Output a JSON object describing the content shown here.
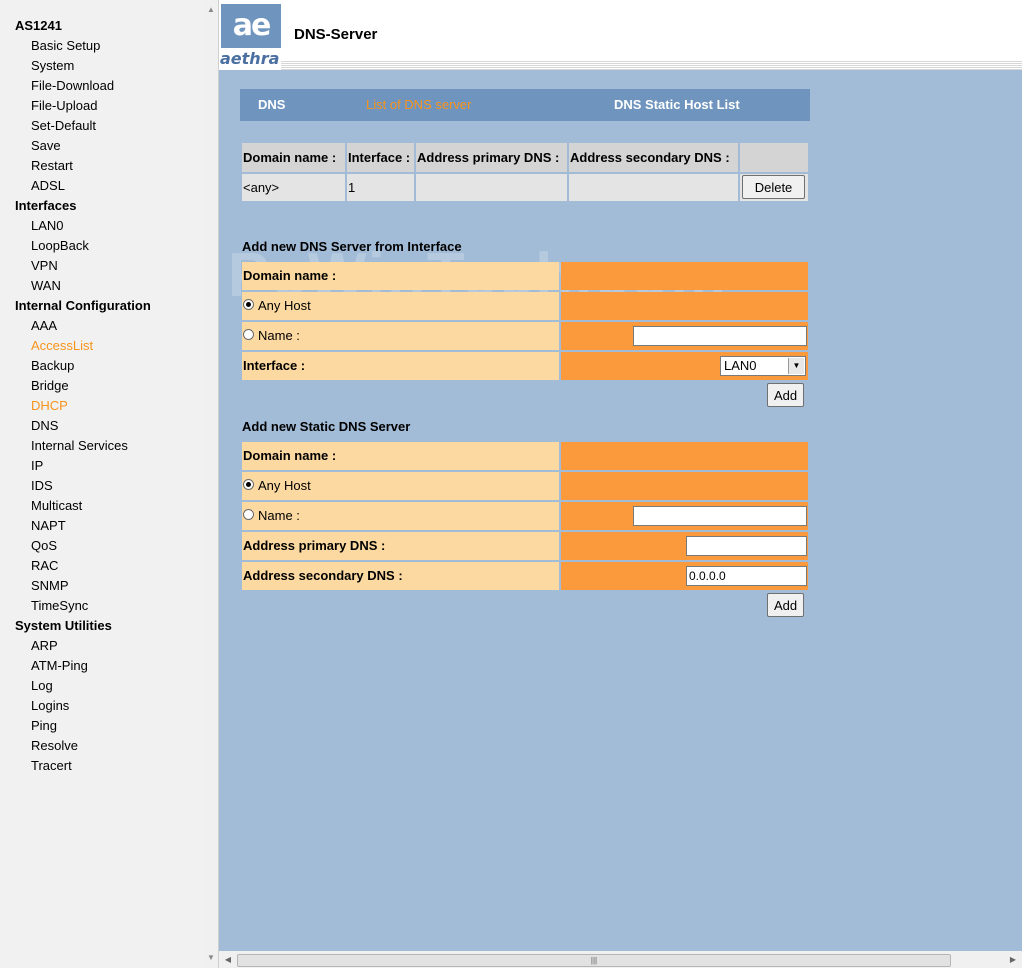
{
  "nav": {
    "groups": [
      {
        "title": "AS1241",
        "items": [
          "Basic Setup",
          "System",
          "File-Download",
          "File-Upload",
          "Set-Default",
          "Save",
          "Restart",
          "ADSL"
        ]
      },
      {
        "title": "Interfaces",
        "items": [
          "LAN0",
          "LoopBack",
          "VPN",
          "WAN"
        ]
      },
      {
        "title": "Internal Configuration",
        "items": [
          "AAA",
          "AccessList",
          "Backup",
          "Bridge",
          "DHCP",
          "DNS",
          "Internal Services",
          "IP",
          "IDS",
          "Multicast",
          "NAPT",
          "QoS",
          "RAC",
          "SNMP",
          "TimeSync"
        ]
      },
      {
        "title": "System Utilities",
        "items": [
          "ARP",
          "ATM-Ping",
          "Log",
          "Logins",
          "Ping",
          "Resolve",
          "Tracert"
        ]
      }
    ],
    "highlight_color": "#f7941d"
  },
  "header": {
    "logo_mark": "ae",
    "logo_word": "aethra",
    "title": "DNS-Server"
  },
  "tabs": [
    "DNS",
    "List of DNS server",
    "DNS Static Host List"
  ],
  "dns_table": {
    "headers": [
      "Domain name :",
      "Interface :",
      "Address primary DNS :",
      "Address secondary DNS :"
    ],
    "rows": [
      {
        "domain": "<any>",
        "interface": "1",
        "primary": "",
        "secondary": "",
        "action": "Delete"
      }
    ]
  },
  "watermark": "PcWinTech.com",
  "iface_form": {
    "title": "Add new DNS Server from Interface",
    "domain_label": "Domain name :",
    "any_host": "Any Host",
    "name_label": "Name :",
    "name_value": "",
    "interface_label": "Interface :",
    "interface_value": "LAN0",
    "add": "Add"
  },
  "static_form": {
    "title": "Add new Static DNS Server",
    "domain_label": "Domain name :",
    "any_host": "Any Host",
    "name_label": "Name :",
    "name_value": "",
    "primary_label": "Address primary DNS :",
    "primary_value": "",
    "secondary_label": "Address secondary DNS :",
    "secondary_value": "0.0.0.0",
    "add": "Add"
  },
  "colors": {
    "content_bg": "#a2bbd6",
    "tab_bar": "#6f95bf",
    "label_bg": "#fcd9a0",
    "field_bg": "#fb9a3d"
  }
}
